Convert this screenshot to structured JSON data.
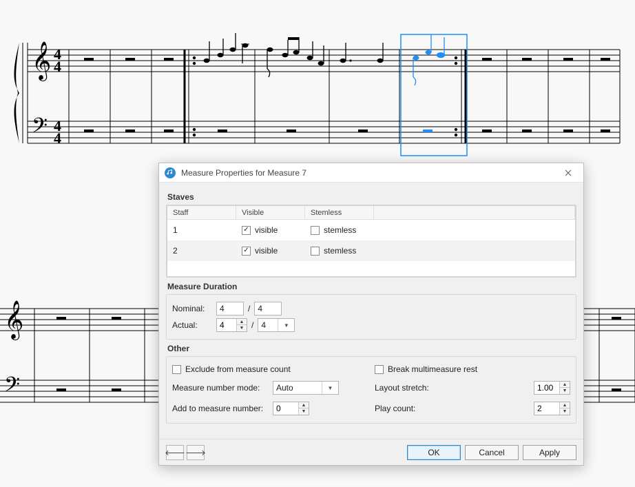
{
  "dialog": {
    "title": "Measure Properties for Measure 7",
    "sections": {
      "staves": "Staves",
      "duration": "Measure Duration",
      "other": "Other"
    },
    "staves_table": {
      "headers": {
        "staff": "Staff",
        "visible": "Visible",
        "stemless": "Stemless"
      },
      "rows": [
        {
          "staff": "1",
          "visible": true,
          "visible_label": "visible",
          "stemless": false,
          "stemless_label": "stemless"
        },
        {
          "staff": "2",
          "visible": true,
          "visible_label": "visible",
          "stemless": false,
          "stemless_label": "stemless"
        }
      ]
    },
    "duration": {
      "nominal_label": "Nominal:",
      "nominal_num": "4",
      "nominal_den": "4",
      "slash": "/",
      "actual_label": "Actual:",
      "actual_num": "4",
      "actual_den": "4"
    },
    "other": {
      "exclude_label": "Exclude from measure count",
      "exclude": false,
      "break_label": "Break multimeasure rest",
      "break": false,
      "measure_mode_label": "Measure number mode:",
      "measure_mode_value": "Auto",
      "layout_label": "Layout stretch:",
      "layout_value": "1.00",
      "add_label": "Add to measure number:",
      "add_value": "0",
      "play_label": "Play count:",
      "play_value": "2"
    },
    "buttons": {
      "ok": "OK",
      "cancel": "Cancel",
      "apply": "Apply"
    }
  },
  "score": {
    "selected_measure": 7
  }
}
